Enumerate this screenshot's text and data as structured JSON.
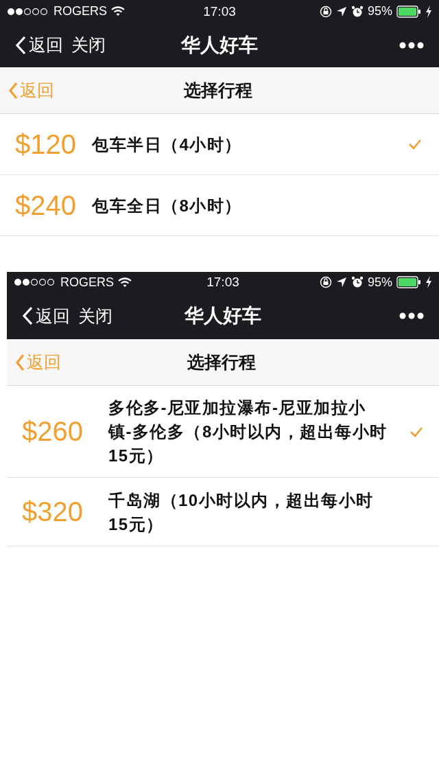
{
  "screens": [
    {
      "status_bar": {
        "carrier": "ROGERS",
        "time": "17:03",
        "battery": "95%"
      },
      "nav_bar": {
        "back": "返回",
        "close": "关闭",
        "title": "华人好车"
      },
      "sub_header": {
        "back": "返回",
        "title": "选择行程"
      },
      "options": [
        {
          "price": "$120",
          "label": "包车半日（4小时）",
          "selected": true
        },
        {
          "price": "$240",
          "label": "包车全日（8小时）",
          "selected": false
        }
      ]
    },
    {
      "status_bar": {
        "carrier": "ROGERS",
        "time": "17:03",
        "battery": "95%"
      },
      "nav_bar": {
        "back": "返回",
        "close": "关闭",
        "title": "华人好车"
      },
      "sub_header": {
        "back": "返回",
        "title": "选择行程"
      },
      "options": [
        {
          "price": "$260",
          "label": "多伦多-尼亚加拉瀑布-尼亚加拉小镇-多伦多（8小时以内，超出每小时15元）",
          "selected": true
        },
        {
          "price": "$320",
          "label": "千岛湖（10小时以内，超出每小时15元）",
          "selected": false
        }
      ]
    }
  ]
}
